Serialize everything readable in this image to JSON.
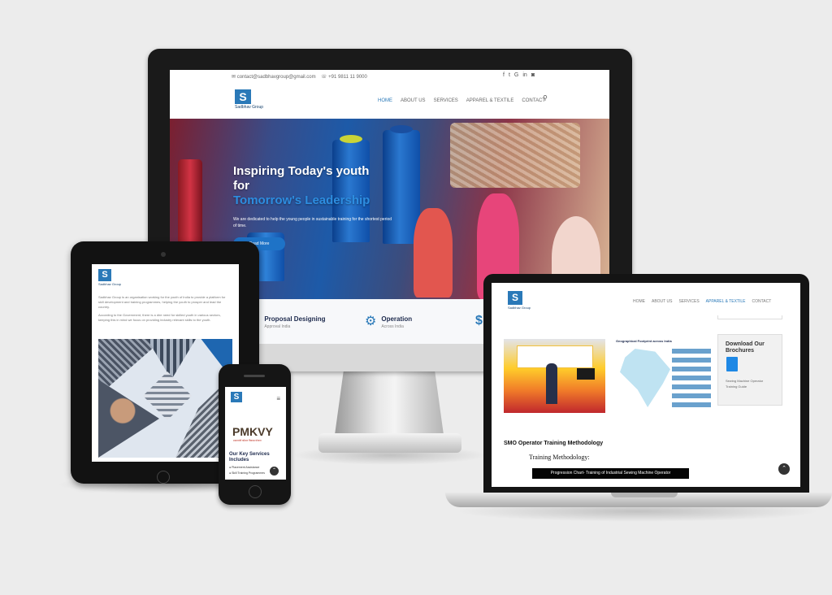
{
  "colors": {
    "background": "#ececec",
    "accent": "#2a79b8",
    "dark_navy": "#1d2a4d"
  },
  "brand": {
    "logo_letter": "S",
    "name": "Sadbhav Group"
  },
  "monitor": {
    "topbar": {
      "email": "contact@sadbhavgroup@gmail.com",
      "phone": "+91 9811 11 9000",
      "social_icons": [
        "facebook-icon",
        "twitter-icon",
        "google-icon",
        "linkedin-icon",
        "instagram-icon"
      ]
    },
    "nav": [
      "HOME",
      "ABOUT US",
      "SERVICES",
      "APPAREL & TEXTILE",
      "CONTACT"
    ],
    "active_nav": "HOME",
    "hero": {
      "title_line1": "Inspiring Today's youth",
      "title_line2": "for",
      "title_line3": "Tomorrow's Leadership",
      "subtitle": "We are dedicated to help the young people in sustainable training for the shortest period of time.",
      "button": "Read More"
    },
    "features": [
      {
        "icon": "checklist-icon",
        "title": "Proposal Designing",
        "sub": "Approval India"
      },
      {
        "icon": "gears-icon",
        "title": "Operation",
        "sub": "Across India"
      }
    ]
  },
  "tablet": {
    "paragraph1": "Sadbhav Group is an organisation working for the youth of India to provide a platform for skill development and training programmes, helping the youth to prosper and lead the country.",
    "paragraph2": "According to the Government, there is a dire need for skilled youth in various sectors, keeping this in mind we focus on providing industry relevant skills to the youth."
  },
  "phone": {
    "pmkvy": "PMKVY",
    "pmkvy_sub": "प्रधानमंत्री कौशल विकास योजना",
    "heading": "Our Key Services Includes",
    "items": [
      "Placement Assistance",
      "Skill Training Programmes"
    ]
  },
  "laptop": {
    "nav": [
      "HOME",
      "ABOUT US",
      "SERVICES",
      "APPAREL & TEXTILE",
      "CONTACT"
    ],
    "active_nav": "APPAREL & TEXTILE",
    "map_title": "Geographical Footprint across India",
    "brochure_title": "Download Our Brochures",
    "brochure_text": "Sewing Machine Operator Training Guide",
    "smo_heading": "SMO Operator Training Methodology",
    "tm_heading": "Training Methodology:",
    "progression_bar": "Progression Chart- Training of Industrial Sewing Machine Operator"
  }
}
